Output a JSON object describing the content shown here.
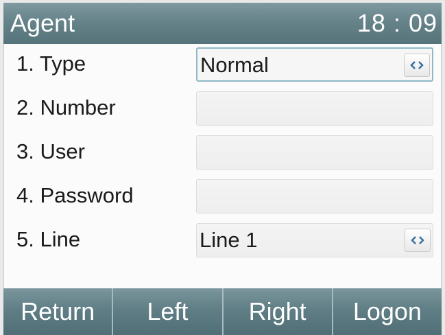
{
  "header": {
    "title": "Agent",
    "time": "18 : 09"
  },
  "form": {
    "rows": [
      {
        "label": "1.  Type",
        "value": "Normal",
        "has_toggle": true,
        "active": true
      },
      {
        "label": "2.  Number",
        "value": "",
        "has_toggle": false,
        "active": false
      },
      {
        "label": "3.  User",
        "value": "",
        "has_toggle": false,
        "active": false
      },
      {
        "label": "4.  Password",
        "value": "",
        "has_toggle": false,
        "active": false
      },
      {
        "label": "5.  Line",
        "value": "Line 1",
        "has_toggle": true,
        "active": false
      }
    ]
  },
  "softkeys": [
    "Return",
    "Left",
    "Right",
    "Logon"
  ],
  "icons": {
    "toggle": "chevron-left-right-icon"
  },
  "colors": {
    "header_bg": "#668389",
    "toggle_arrow": "#3a6fa0",
    "active_border": "#8fb9c5"
  }
}
